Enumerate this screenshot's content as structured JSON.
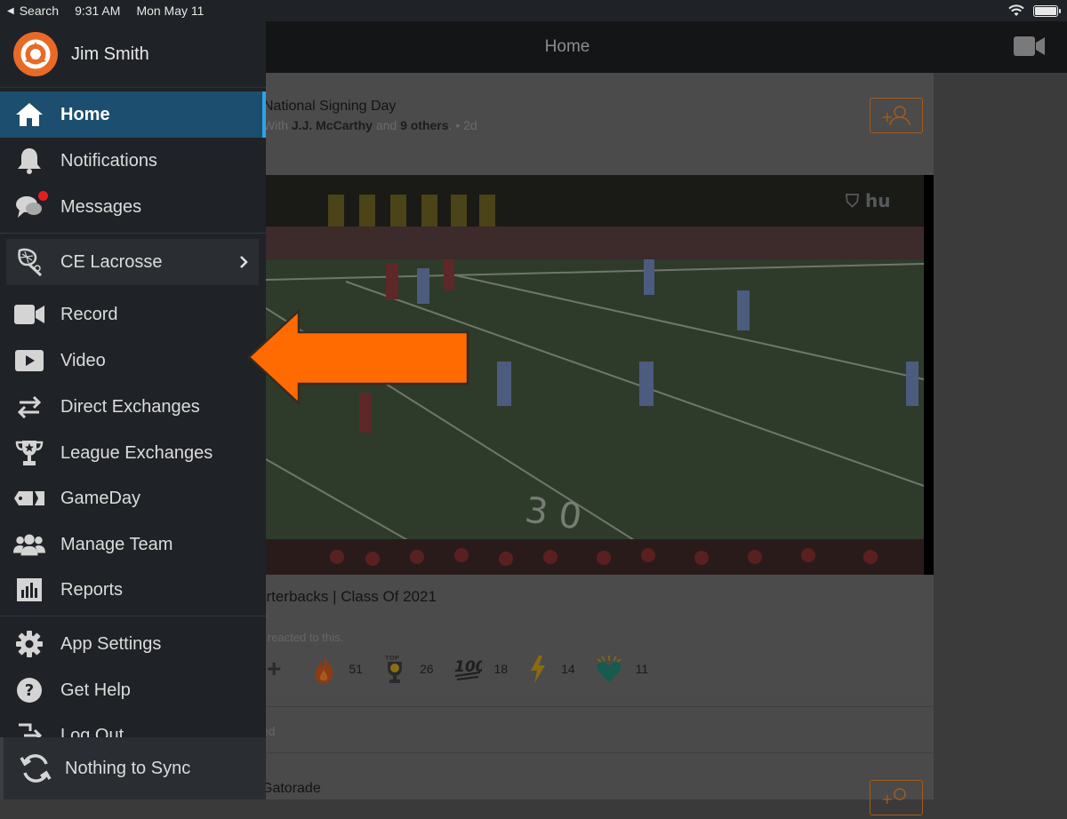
{
  "status_bar": {
    "back_label": "Search",
    "time": "9:31 AM",
    "date": "Mon May 11"
  },
  "header": {
    "title": "Home"
  },
  "sidebar": {
    "user_name": "Jim Smith",
    "items": [
      {
        "label": "Home"
      },
      {
        "label": "Notifications"
      },
      {
        "label": "Messages"
      },
      {
        "label": "CE Lacrosse"
      },
      {
        "label": "Record"
      },
      {
        "label": "Video"
      },
      {
        "label": "Direct Exchanges"
      },
      {
        "label": "League Exchanges"
      },
      {
        "label": "GameDay"
      },
      {
        "label": "Manage Team"
      },
      {
        "label": "Reports"
      },
      {
        "label": "App Settings"
      },
      {
        "label": "Get Help"
      },
      {
        "label": "Log Out"
      }
    ],
    "sync_label": "Nothing to Sync"
  },
  "feed": {
    "post1": {
      "title": "National Signing Day",
      "meta_prefix": "With ",
      "meta_name": "J.J. McCarthy",
      "meta_mid": " and ",
      "meta_others": "9 others",
      "meta_suffix": ". • 2d",
      "caption": "arterbacks | Class Of 2021",
      "reacted_text": "e reacted to this.",
      "reactions": [
        {
          "icon": "fire-icon",
          "count": "51"
        },
        {
          "icon": "top5-trophy-icon",
          "count": "26"
        },
        {
          "icon": "hundred-icon",
          "count": "18"
        },
        {
          "icon": "lightning-icon",
          "count": "14"
        },
        {
          "icon": "heart-burst-icon",
          "count": "11"
        }
      ]
    },
    "partial_text": "ed",
    "post2": {
      "title": "Gatorade"
    }
  },
  "colors": {
    "sidebar_bg": "#1f2226",
    "active_bg": "#1b4e6f",
    "active_accent": "#2da3e8",
    "brand_orange": "#ff6b00",
    "notification_dot": "#e02020"
  }
}
